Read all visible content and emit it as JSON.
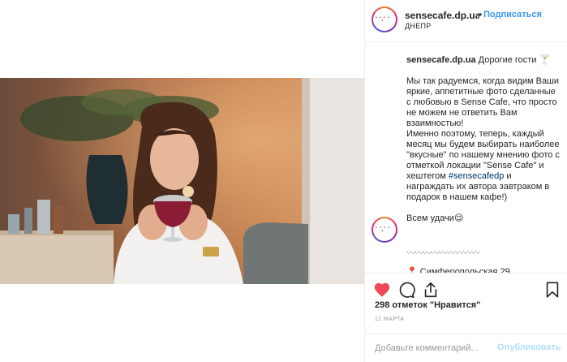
{
  "photo": {
    "alt_icon": "photo-woman-with-drink"
  },
  "header": {
    "username": "sensecafe.dp.ua",
    "separator": "•",
    "follow_label": "Подписаться",
    "location": "ДНЕПР"
  },
  "caption": {
    "author": "sensecafe.dp.ua",
    "text_lead": " Дорогие гости 🍸\n\nМы так радуемся, когда видим Ваши яркие, аппетитные фото сделанные с любовью в Sense Cafe, что просто не можем не ответить Вам взаимностью!\nИменно поэтому, теперь, каждый месяц мы будем выбирать наиболее \"вкусные\" по нашему мнению фото с отметкой локации \"Sense Cafe\" и хештегом ",
    "hashtag": "#sensecafedp",
    "text_tail": " и награждать их автора завтраком в подарок в нашем кафе!)\n\nВсем удачи😌",
    "wave": "〰〰〰〰〰〰〰〰〰",
    "cut_line": "📍 Симферопольская 29"
  },
  "actions": {
    "like_icon": "heart-filled-icon",
    "like_color": "#ed4956",
    "comment_icon": "comment-icon",
    "share_icon": "share-icon",
    "save_icon": "bookmark-icon"
  },
  "likes_text": "298 отметок \"Нравится\"",
  "date_text": "12 МАРТА",
  "comment": {
    "placeholder": "Добавьте комментарий...",
    "publish_label": "Опубликовать"
  }
}
